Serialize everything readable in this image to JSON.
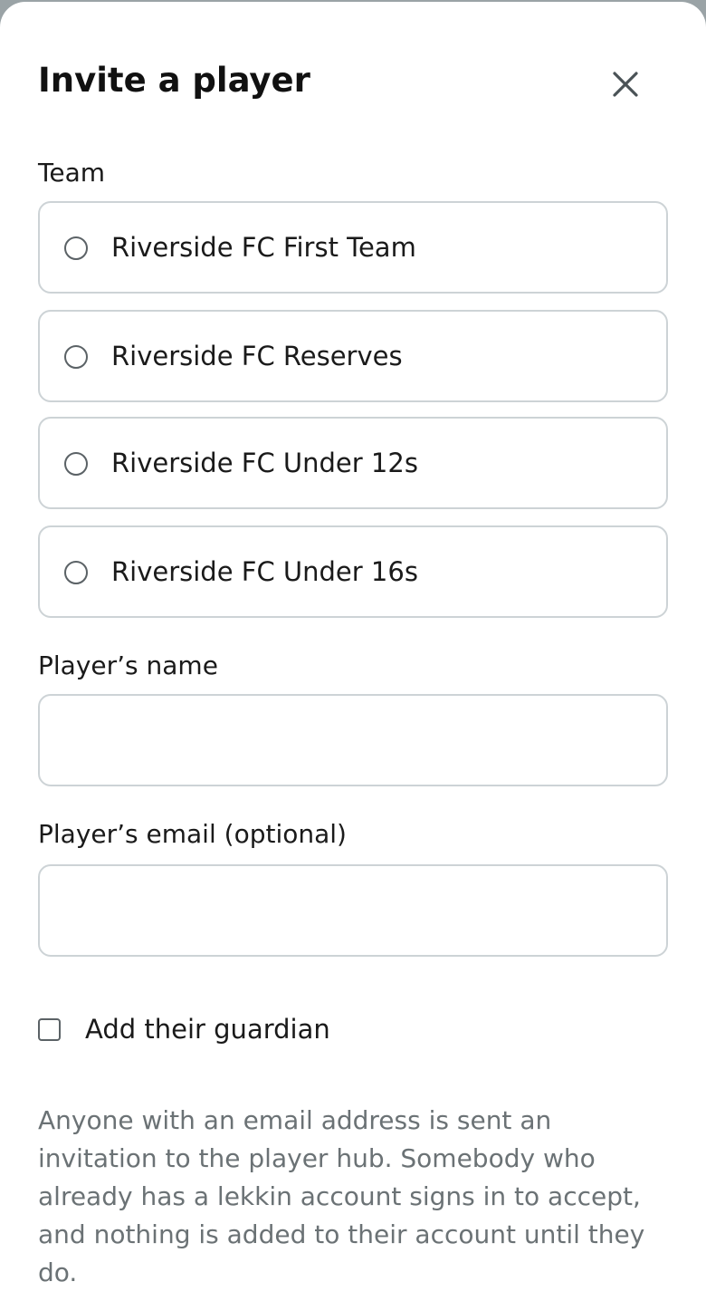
{
  "dialog": {
    "title": "Invite a player",
    "close_label": "close"
  },
  "team": {
    "label": "Team",
    "options": [
      {
        "label": "Riverside FC First Team",
        "selected": false
      },
      {
        "label": "Riverside FC Reserves",
        "selected": false
      },
      {
        "label": "Riverside FC Under 12s",
        "selected": false
      },
      {
        "label": "Riverside FC Under 16s",
        "selected": false
      }
    ]
  },
  "player_name": {
    "label": "Player’s name",
    "value": ""
  },
  "player_email": {
    "label": "Player’s email (optional)",
    "value": ""
  },
  "guardian": {
    "label": "Add their guardian",
    "checked": false
  },
  "info": {
    "text": "Anyone with an email address is sent an invitation to the player hub. Somebody who already has a lekkin account signs in to accept, and nothing is added to their account until they do."
  },
  "colors": {
    "border": "#cdd3d6",
    "text": "#1a1a1a",
    "muted_text": "#6b7275",
    "backdrop": "#9aa3a6"
  },
  "icons": {
    "close": "close-icon",
    "radio": "radio-icon",
    "checkbox": "checkbox-icon"
  }
}
